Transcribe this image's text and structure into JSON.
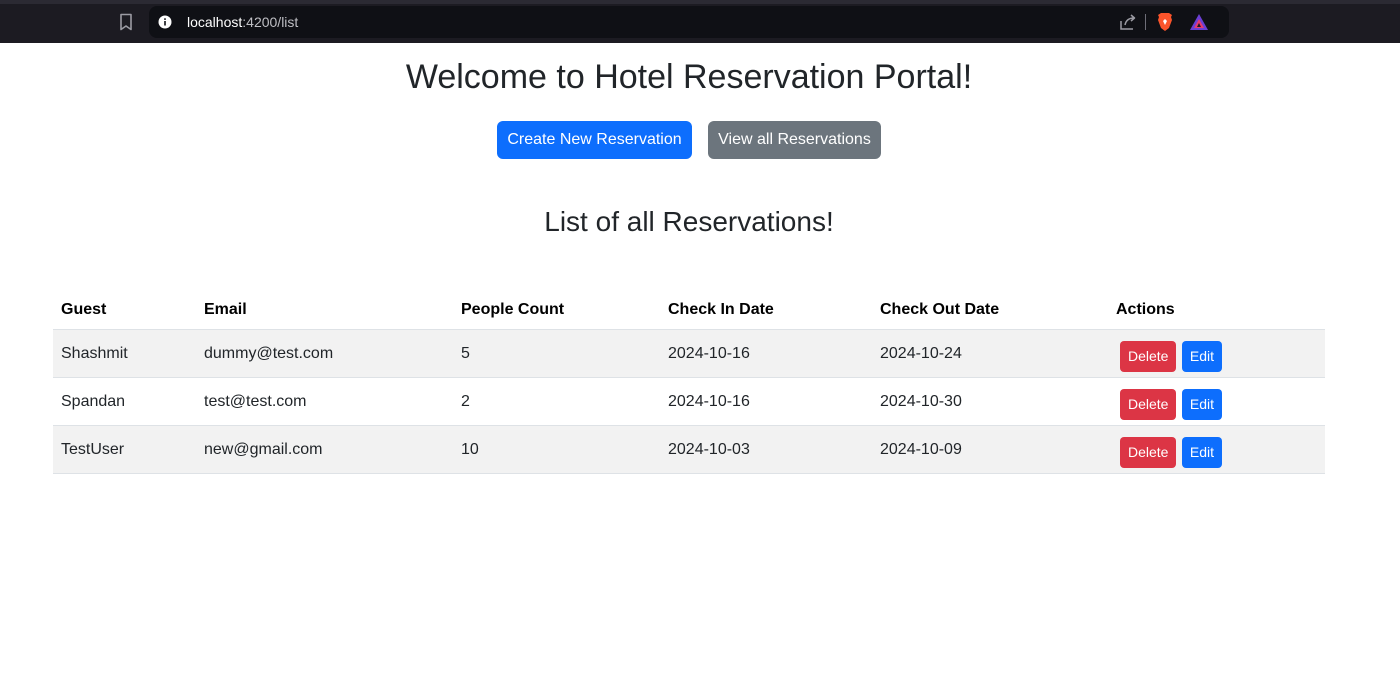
{
  "browser": {
    "url_host": "localhost",
    "url_rest": ":4200/list"
  },
  "page": {
    "title": "Welcome to Hotel Reservation Portal!",
    "create_button": "Create New Reservation",
    "view_button": "View all Reservations",
    "list_title": "List of all Reservations!"
  },
  "table": {
    "headers": {
      "guest": "Guest",
      "email": "Email",
      "people": "People Count",
      "check_in": "Check In Date",
      "check_out": "Check Out Date",
      "actions": "Actions"
    },
    "rows": [
      {
        "guest": "Shashmit",
        "email": "dummy@test.com",
        "people": "5",
        "check_in": "2024-10-16",
        "check_out": "2024-10-24"
      },
      {
        "guest": "Spandan",
        "email": "test@test.com",
        "people": "2",
        "check_in": "2024-10-16",
        "check_out": "2024-10-30"
      },
      {
        "guest": "TestUser",
        "email": "new@gmail.com",
        "people": "10",
        "check_in": "2024-10-03",
        "check_out": "2024-10-09"
      }
    ],
    "delete_label": "Delete",
    "edit_label": "Edit"
  },
  "colors": {
    "primary": "#0d6efd",
    "secondary": "#6c757d",
    "danger": "#dc3545"
  }
}
